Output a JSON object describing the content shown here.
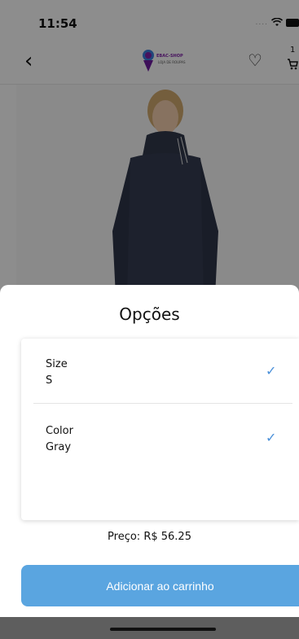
{
  "status_bar": {
    "time": "11:54"
  },
  "app_bar": {
    "brand": "EBAC-SHOP",
    "brand_sub": "LOJA DE ROUPAS",
    "cart_count": "1"
  },
  "sheet": {
    "title": "Opções",
    "options": [
      {
        "name": "Size",
        "value": "S",
        "selected": true
      },
      {
        "name": "Color",
        "value": "Gray",
        "selected": true
      }
    ],
    "price": "Preço: R$ 56.25",
    "add_button": "Adicionar ao carrinho"
  },
  "colors": {
    "accent": "#5aa5e0",
    "check": "#4a90d9",
    "brand": "#7b1fa2",
    "product": "#2f3648"
  }
}
